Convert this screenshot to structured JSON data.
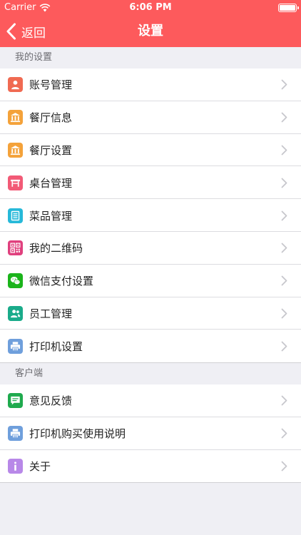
{
  "status": {
    "carrier": "Carrier",
    "time": "6:06 PM"
  },
  "nav": {
    "back_label": "返回",
    "title": "设置"
  },
  "sections": [
    {
      "header": "我的设置",
      "items": [
        {
          "label": "账号管理",
          "icon": "user-icon",
          "color": "#f06a52"
        },
        {
          "label": "餐厅信息",
          "icon": "building-icon",
          "color": "#f4a23a"
        },
        {
          "label": "餐厅设置",
          "icon": "building-icon",
          "color": "#f4a23a"
        },
        {
          "label": "桌台管理",
          "icon": "table-icon",
          "color": "#f25a76"
        },
        {
          "label": "菜品管理",
          "icon": "list-icon",
          "color": "#27b9d9"
        },
        {
          "label": "我的二维码",
          "icon": "qrcode-icon",
          "color": "#e0407e"
        },
        {
          "label": "微信支付设置",
          "icon": "wechat-icon",
          "color": "#1bb41b"
        },
        {
          "label": "员工管理",
          "icon": "staff-icon",
          "color": "#1aab8a"
        },
        {
          "label": "打印机设置",
          "icon": "printer-icon",
          "color": "#6f9fdc"
        }
      ]
    },
    {
      "header": "客户端",
      "items": [
        {
          "label": "意见反馈",
          "icon": "feedback-icon",
          "color": "#1faa4e"
        },
        {
          "label": "打印机购买使用说明",
          "icon": "printer-icon",
          "color": "#6f9fdc"
        },
        {
          "label": "关于",
          "icon": "info-icon",
          "color": "#b888e8"
        }
      ]
    }
  ]
}
